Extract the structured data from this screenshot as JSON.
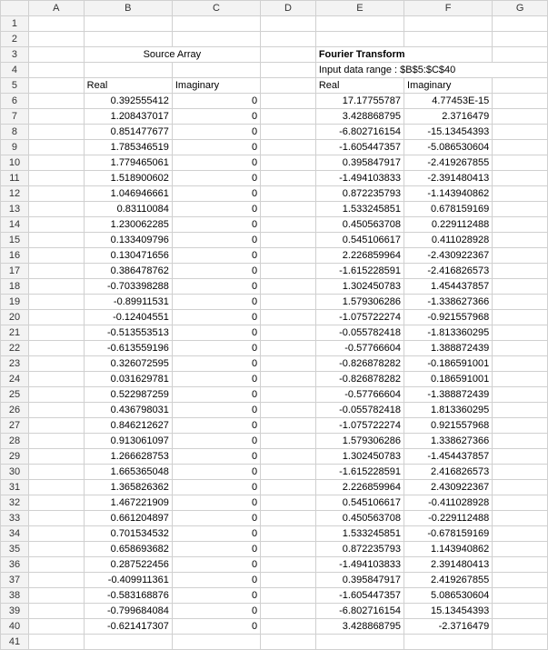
{
  "columns": [
    "A",
    "B",
    "C",
    "D",
    "E",
    "F",
    "G"
  ],
  "row_headers": [
    "1",
    "2",
    "3",
    "4",
    "5",
    "6",
    "7",
    "8",
    "9",
    "10",
    "11",
    "12",
    "13",
    "14",
    "15",
    "16",
    "17",
    "18",
    "19",
    "20",
    "21",
    "22",
    "23",
    "24",
    "25",
    "26",
    "27",
    "28",
    "29",
    "30",
    "31",
    "32",
    "33",
    "34",
    "35",
    "36",
    "37",
    "38",
    "39",
    "40",
    "41"
  ],
  "headers": {
    "source_array": "Source Array",
    "fourier_transform": "Fourier Transform",
    "input_range": "Input data range : $B$5:$C$40",
    "real": "Real",
    "imaginary": "Imaginary"
  },
  "chart_data": {
    "type": "table",
    "title": "Fourier Transform",
    "source_label": "Source Array",
    "input_range": "$B$5:$C$40",
    "columns": [
      "Source Real",
      "Source Imaginary",
      "FT Real",
      "FT Imaginary"
    ],
    "rows": [
      {
        "src_real": "0.392555412",
        "src_imag": "0",
        "ft_real": "17.17755787",
        "ft_imag": "4.77453E-15"
      },
      {
        "src_real": "1.208437017",
        "src_imag": "0",
        "ft_real": "3.428868795",
        "ft_imag": "2.3716479"
      },
      {
        "src_real": "0.851477677",
        "src_imag": "0",
        "ft_real": "-6.802716154",
        "ft_imag": "-15.13454393"
      },
      {
        "src_real": "1.785346519",
        "src_imag": "0",
        "ft_real": "-1.605447357",
        "ft_imag": "-5.086530604"
      },
      {
        "src_real": "1.779465061",
        "src_imag": "0",
        "ft_real": "0.395847917",
        "ft_imag": "-2.419267855"
      },
      {
        "src_real": "1.518900602",
        "src_imag": "0",
        "ft_real": "-1.494103833",
        "ft_imag": "-2.391480413"
      },
      {
        "src_real": "1.046946661",
        "src_imag": "0",
        "ft_real": "0.872235793",
        "ft_imag": "-1.143940862"
      },
      {
        "src_real": "0.83110084",
        "src_imag": "0",
        "ft_real": "1.533245851",
        "ft_imag": "0.678159169"
      },
      {
        "src_real": "1.230062285",
        "src_imag": "0",
        "ft_real": "0.450563708",
        "ft_imag": "0.229112488"
      },
      {
        "src_real": "0.133409796",
        "src_imag": "0",
        "ft_real": "0.545106617",
        "ft_imag": "0.411028928"
      },
      {
        "src_real": "0.130471656",
        "src_imag": "0",
        "ft_real": "2.226859964",
        "ft_imag": "-2.430922367"
      },
      {
        "src_real": "0.386478762",
        "src_imag": "0",
        "ft_real": "-1.615228591",
        "ft_imag": "-2.416826573"
      },
      {
        "src_real": "-0.703398288",
        "src_imag": "0",
        "ft_real": "1.302450783",
        "ft_imag": "1.454437857"
      },
      {
        "src_real": "-0.89911531",
        "src_imag": "0",
        "ft_real": "1.579306286",
        "ft_imag": "-1.338627366"
      },
      {
        "src_real": "-0.12404551",
        "src_imag": "0",
        "ft_real": "-1.075722274",
        "ft_imag": "-0.921557968"
      },
      {
        "src_real": "-0.513553513",
        "src_imag": "0",
        "ft_real": "-0.055782418",
        "ft_imag": "-1.813360295"
      },
      {
        "src_real": "-0.613559196",
        "src_imag": "0",
        "ft_real": "-0.57766604",
        "ft_imag": "1.388872439"
      },
      {
        "src_real": "0.326072595",
        "src_imag": "0",
        "ft_real": "-0.826878282",
        "ft_imag": "-0.186591001"
      },
      {
        "src_real": "0.031629781",
        "src_imag": "0",
        "ft_real": "-0.826878282",
        "ft_imag": "0.186591001"
      },
      {
        "src_real": "0.522987259",
        "src_imag": "0",
        "ft_real": "-0.57766604",
        "ft_imag": "-1.388872439"
      },
      {
        "src_real": "0.436798031",
        "src_imag": "0",
        "ft_real": "-0.055782418",
        "ft_imag": "1.813360295"
      },
      {
        "src_real": "0.846212627",
        "src_imag": "0",
        "ft_real": "-1.075722274",
        "ft_imag": "0.921557968"
      },
      {
        "src_real": "0.913061097",
        "src_imag": "0",
        "ft_real": "1.579306286",
        "ft_imag": "1.338627366"
      },
      {
        "src_real": "1.266628753",
        "src_imag": "0",
        "ft_real": "1.302450783",
        "ft_imag": "-1.454437857"
      },
      {
        "src_real": "1.665365048",
        "src_imag": "0",
        "ft_real": "-1.615228591",
        "ft_imag": "2.416826573"
      },
      {
        "src_real": "1.365826362",
        "src_imag": "0",
        "ft_real": "2.226859964",
        "ft_imag": "2.430922367"
      },
      {
        "src_real": "1.467221909",
        "src_imag": "0",
        "ft_real": "0.545106617",
        "ft_imag": "-0.411028928"
      },
      {
        "src_real": "0.661204897",
        "src_imag": "0",
        "ft_real": "0.450563708",
        "ft_imag": "-0.229112488"
      },
      {
        "src_real": "0.701534532",
        "src_imag": "0",
        "ft_real": "1.533245851",
        "ft_imag": "-0.678159169"
      },
      {
        "src_real": "0.658693682",
        "src_imag": "0",
        "ft_real": "0.872235793",
        "ft_imag": "1.143940862"
      },
      {
        "src_real": "0.287522456",
        "src_imag": "0",
        "ft_real": "-1.494103833",
        "ft_imag": "2.391480413"
      },
      {
        "src_real": "-0.409911361",
        "src_imag": "0",
        "ft_real": "0.395847917",
        "ft_imag": "2.419267855"
      },
      {
        "src_real": "-0.583168876",
        "src_imag": "0",
        "ft_real": "-1.605447357",
        "ft_imag": "5.086530604"
      },
      {
        "src_real": "-0.799684084",
        "src_imag": "0",
        "ft_real": "-6.802716154",
        "ft_imag": "15.13454393"
      },
      {
        "src_real": "-0.621417307",
        "src_imag": "0",
        "ft_real": "3.428868795",
        "ft_imag": "-2.3716479"
      }
    ]
  }
}
